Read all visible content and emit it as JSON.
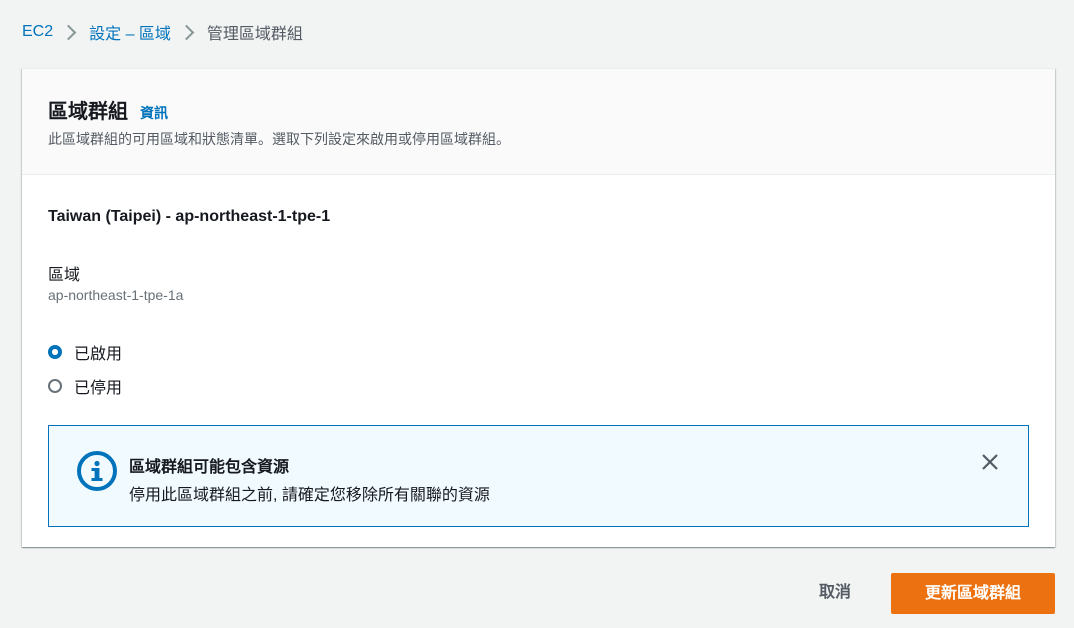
{
  "breadcrumb": {
    "items": [
      {
        "label": "EC2"
      },
      {
        "label": "設定 – 區域"
      },
      {
        "label": "管理區域群組"
      }
    ]
  },
  "panel": {
    "title": "區域群組",
    "info_link": "資訊",
    "description": "此區域群組的可用區域和狀態清單。選取下列設定來啟用或停用區域群組。",
    "group_name": "Taiwan (Taipei) - ap-northeast-1-tpe-1",
    "zone_label": "區域",
    "zone_value": "ap-northeast-1-tpe-1a",
    "options": [
      {
        "label": "已啟用",
        "selected": true
      },
      {
        "label": "已停用",
        "selected": false
      }
    ]
  },
  "alert": {
    "icon": "info-icon",
    "title": "區域群組可能包含資源",
    "text": "停用此區域群組之前, 請確定您移除所有關聯的資源"
  },
  "actions": {
    "cancel_label": "取消",
    "submit_label": "更新區域群組"
  },
  "colors": {
    "accent": "#0073bb",
    "primary_button": "#ec7211",
    "alert_background": "#f1faff"
  }
}
